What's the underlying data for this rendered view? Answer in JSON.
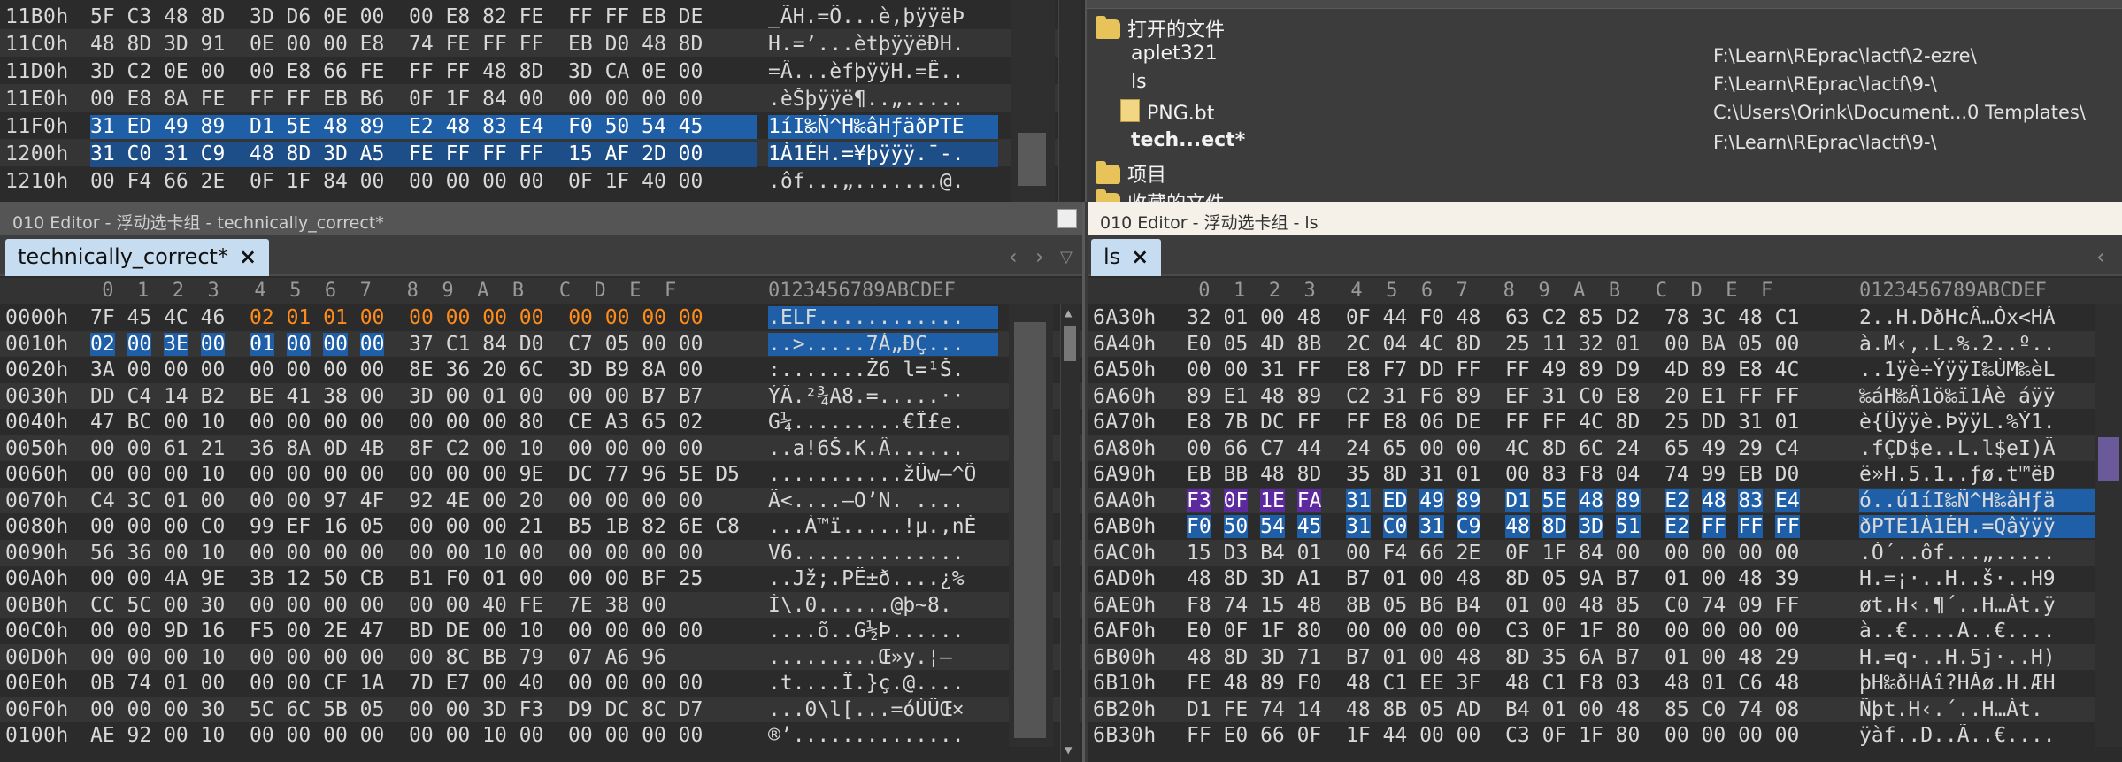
{
  "top_hex": {
    "rows": [
      {
        "addr": "11B0h",
        "hex": "5F C3 48 8D  3D D6 0E 00  00 E8 82 FE  FF FF EB DE",
        "ascii": "_ÃH.=Ö...è,þÿÿëÞ"
      },
      {
        "addr": "11C0h",
        "hex": "48 8D 3D 91  0E 00 00 E8  74 FE FF FF  EB D0 48 8D",
        "ascii": "H.=’...ètþÿÿëÐH."
      },
      {
        "addr": "11D0h",
        "hex": "3D C2 0E 00  00 E8 66 FE  FF FF 48 8D  3D CA 0E 00",
        "ascii": "=Â...èfþÿÿH.=Ê.."
      },
      {
        "addr": "11E0h",
        "hex": "00 E8 8A FE  FF FF EB B6  0F 1F 84 00  00 00 00 00",
        "ascii": ".èŠþÿÿë¶..„....."
      },
      {
        "addr": "11F0h",
        "hex": "31 ED 49 89  D1 5E 48 89  E2 48 83 E4  F0 50 54 45",
        "ascii": "1íI‰Ñ^H‰âHƒäðPTE"
      },
      {
        "addr": "1200h",
        "hex": "31 C0 31 C9  48 8D 3D A5  FE FF FF FF  15 AF 2D 00",
        "ascii": "1À1ÉH.=¥þÿÿÿ.¯-."
      },
      {
        "addr": "1210h",
        "hex": "00 F4 66 2E  0F 1F 84 00  00 00 00 00  0F 1F 40 00",
        "ascii": ".ôf...„.......@."
      }
    ]
  },
  "files_panel": {
    "open_files_label": "打开的文件",
    "items": [
      {
        "name": "aplet321",
        "path": "F:\\Learn\\REprac\\lactf\\2-ezre\\"
      },
      {
        "name": "ls",
        "path": "F:\\Learn\\REprac\\lactf\\9-\\"
      },
      {
        "name": "PNG.bt",
        "path": "C:\\Users\\Orink\\Document...0 Templates\\"
      },
      {
        "name": "tech...ect*",
        "path": "F:\\Learn\\REprac\\lactf\\9-\\"
      }
    ],
    "project_label": "项目",
    "favorites_label": "收藏的文件"
  },
  "left_editor": {
    "title": "010 Editor - 浮动选卡组 - technically_correct*",
    "tab_label": "technically_correct*",
    "hex_header": " 0  1  2  3   4  5  6  7   8  9  A  B   C  D  E  F",
    "ascii_header": "0123456789ABCDEF",
    "rows": [
      {
        "addr": "0000h",
        "hex": "7F 45 4C 46  02 01 01 00  00 00 00 00  00 00 00 00",
        "ascii": ".ELF............"
      },
      {
        "addr": "0010h",
        "hex": "02 00 3E 00  01 00 00 00  37 C1 84 D0  C7 05 00 00",
        "ascii": "..>.....7Á„ÐÇ..."
      },
      {
        "addr": "0020h",
        "hex": "3A 00 00 00  00 00 00 00  8E 36 20 6C  3D B9 8A 00",
        "ascii": ":.......Ž6 l=¹Š."
      },
      {
        "addr": "0030h",
        "hex": "DD C4 14 B2  BE 41 38 00  3D 00 01 00  00 00 B7 B7",
        "ascii": "ÝÄ.²¾A8.=.....··"
      },
      {
        "addr": "0040h",
        "hex": "47 BC 00 10  00 00 00 00  00 00 00 80  CE A3 65 02",
        "ascii": "G¼.........€Î£e."
      },
      {
        "addr": "0050h",
        "hex": "00 00 61 21  36 8A 0D 4B  8F C2 00 10  00 00 00 00",
        "ascii": "..a!6Š.K.Â......"
      },
      {
        "addr": "0060h",
        "hex": "00 00 00 10  00 00 00 00  00 00 00 9E  DC 77 96 5E D5",
        "ascii": "...........žÜw–^Õ"
      },
      {
        "addr": "0070h",
        "hex": "C4 3C 01 00  00 00 97 4F  92 4E 00 20  00 00 00 00",
        "ascii": "Ä<....—O’N. ...."
      },
      {
        "addr": "0080h",
        "hex": "00 00 00 C0  99 EF 16 05  00 00 00 21  B5 1B 82 6E C8",
        "ascii": "...À™ï.....!µ.‚nÈ"
      },
      {
        "addr": "0090h",
        "hex": "56 36 00 10  00 00 00 00  00 00 10 00  00 00 00 00",
        "ascii": "V6.............."
      },
      {
        "addr": "00A0h",
        "hex": "00 00 4A 9E  3B 12 50 CB  B1 F0 01 00  00 00 BF 25",
        "ascii": "..Jž;.PË±ð....¿%"
      },
      {
        "addr": "00B0h",
        "hex": "CC 5C 00 30  00 00 00 00  00 00 40 FE  7E 38 00",
        "ascii": "Ì\\.0......@þ~8."
      },
      {
        "addr": "00C0h",
        "hex": "00 00 9D 16  F5 00 2E 47  BD DE 00 10  00 00 00 00",
        "ascii": "....õ..G½Þ......"
      },
      {
        "addr": "00D0h",
        "hex": "00 00 00 10  00 00 00 00  00 8C BB 79  07 A6 96",
        "ascii": ".........Œ»y.¦–"
      },
      {
        "addr": "00E0h",
        "hex": "0B 74 01 00  00 00 CF 1A  7D E7 00 40  00 00 00 00",
        "ascii": ".t....Ï.}ç.@...."
      },
      {
        "addr": "00F0h",
        "hex": "00 00 00 30  5C 6C 5B 05  00 00 3D F3  D9 DC 8C D7",
        "ascii": "...0\\l[...=óÙÜŒ×"
      },
      {
        "addr": "0100h",
        "hex": "AE 92 00 10  00 00 00 00  00 00 10 00  00 00 00 00",
        "ascii": "®’.............."
      }
    ]
  },
  "right_editor": {
    "title": "010 Editor - 浮动选卡组 - ls",
    "tab_label": "ls",
    "hex_header": " 0  1  2  3   4  5  6  7   8  9  A  B   C  D  E  F",
    "ascii_header": "0123456789ABCDEF",
    "rows": [
      {
        "addr": "6A30h",
        "hex": "32 01 00 48  0F 44 F0 48  63 C2 85 D2  78 3C 48 C1",
        "ascii": "2..H.DðHcÂ…Òx<HÁ"
      },
      {
        "addr": "6A40h",
        "hex": "E0 05 4D 8B  2C 04 4C 8D  25 11 32 01  00 BA 05 00",
        "ascii": "à.M‹,.L.%.2..º.."
      },
      {
        "addr": "6A50h",
        "hex": "00 00 31 FF  E8 F7 DD FF  FF 49 89 D9  4D 89 E8 4C",
        "ascii": "..1ÿè÷ÝÿÿI‰ÙM‰èL"
      },
      {
        "addr": "6A60h",
        "hex": "89 E1 48 89  C2 31 F6 89  EF 31 C0 E8  20 E1 FF FF",
        "ascii": "‰áH‰Â1ö‰ï1Àè áÿÿ"
      },
      {
        "addr": "6A70h",
        "hex": "E8 7B DC FF  FF E8 06 DE  FF FF 4C 8D  25 DD 31 01",
        "ascii": "è{Üÿÿè.ÞÿÿL.%Ý1."
      },
      {
        "addr": "6A80h",
        "hex": "00 66 C7 44  24 65 00 00  4C 8D 6C 24  65 49 29 C4",
        "ascii": ".fÇD$e..L.l$eI)Ä"
      },
      {
        "addr": "6A90h",
        "hex": "EB BB 48 8D  35 8D 31 01  00 83 F8 04  74 99 EB D0",
        "ascii": "ë»H.5.1..ƒø.t™ëÐ"
      },
      {
        "addr": "6AA0h",
        "hex": "F3 0F 1E FA  31 ED 49 89  D1 5E 48 89  E2 48 83 E4",
        "ascii": "ó..ú1íI‰Ñ^H‰âHƒä"
      },
      {
        "addr": "6AB0h",
        "hex": "F0 50 54 45  31 C0 31 C9  48 8D 3D 51  E2 FF FF FF",
        "ascii": "ðPTE1À1ÉH.=Qâÿÿÿ"
      },
      {
        "addr": "6AC0h",
        "hex": "15 D3 B4 01  00 F4 66 2E  0F 1F 84 00  00 00 00 00",
        "ascii": ".Ó´..ôf...„....."
      },
      {
        "addr": "6AD0h",
        "hex": "48 8D 3D A1  B7 01 00 48  8D 05 9A B7  01 00 48 39",
        "ascii": "H.=¡·..H..š·..H9"
      },
      {
        "addr": "6AE0h",
        "hex": "F8 74 15 48  8B 05 B6 B4  01 00 48 85  C0 74 09 FF",
        "ascii": "øt.H‹.¶´..H…Àt.ÿ"
      },
      {
        "addr": "6AF0h",
        "hex": "E0 0F 1F 80  00 00 00 00  C3 0F 1F 80  00 00 00 00",
        "ascii": "à..€....Ã..€...."
      },
      {
        "addr": "6B00h",
        "hex": "48 8D 3D 71  B7 01 00 48  8D 35 6A B7  01 00 48 29",
        "ascii": "H.=q·..H.5j·..H)"
      },
      {
        "addr": "6B10h",
        "hex": "FE 48 89 F0  48 C1 EE 3F  48 C1 F8 03  48 01 C6 48",
        "ascii": "þH‰ðHÁî?HÁø.H.ÆH"
      },
      {
        "addr": "6B20h",
        "hex": "D1 FE 74 14  48 8B 05 AD  B4 01 00 48  85 C0 74 08",
        "ascii": "Ñþt.H‹.­´..H…Àt."
      },
      {
        "addr": "6B30h",
        "hex": "FF E0 66 0F  1F 44 00 00  C3 0F 1F 80  00 00 00 00",
        "ascii": "ÿàf..D..Ã..€...."
      }
    ]
  },
  "colors": {
    "selection": "#1f5fa8",
    "header_orange": "#ff8c1a",
    "purple": "#5c2a9e",
    "tab_bg": "#c6dcf0"
  }
}
